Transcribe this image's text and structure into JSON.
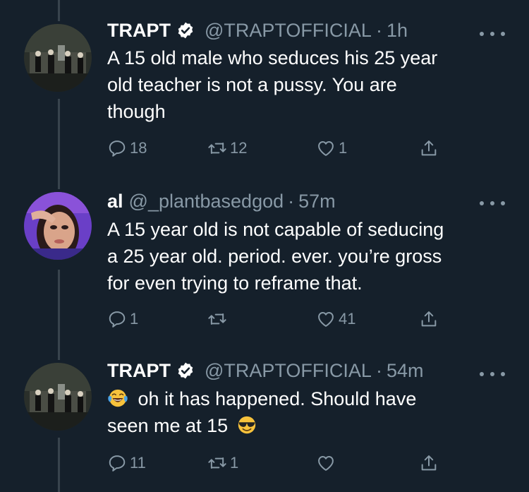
{
  "colors": {
    "background": "#15202b",
    "secondary_text": "#8899a6",
    "thread_line": "#38444d"
  },
  "tweets": [
    {
      "author_name": "TRAPT",
      "verified": true,
      "handle": "@TRAPTOFFICIAL",
      "separator": "·",
      "time": "1h",
      "lines": [
        "A 15 old male who seduces his 25 year",
        "old teacher is not a pussy. You are",
        "though"
      ],
      "reply_count": "18",
      "retweet_count": "12",
      "like_count": "1",
      "avatar_icon": "band-photo-avatar"
    },
    {
      "author_name": "al",
      "verified": false,
      "handle": "@_plantbasedgod",
      "separator": "·",
      "time": "57m",
      "lines": [
        "A 15 year old is not capable of seducing",
        "a 25 year old. period. ever. you’re gross",
        "for even trying to reframe that."
      ],
      "reply_count": "1",
      "retweet_count": "",
      "like_count": "41",
      "avatar_icon": "selfie-avatar"
    },
    {
      "author_name": "TRAPT",
      "verified": true,
      "handle": "@TRAPTOFFICIAL",
      "separator": "·",
      "time": "54m",
      "line1": "oh it has happened. Should have",
      "line2": "seen me at 15",
      "emoji_start": "face-with-tears-of-joy",
      "emoji_end": "smiling-face-with-sunglasses",
      "reply_count": "11",
      "retweet_count": "1",
      "like_count": "",
      "avatar_icon": "band-photo-avatar"
    }
  ]
}
